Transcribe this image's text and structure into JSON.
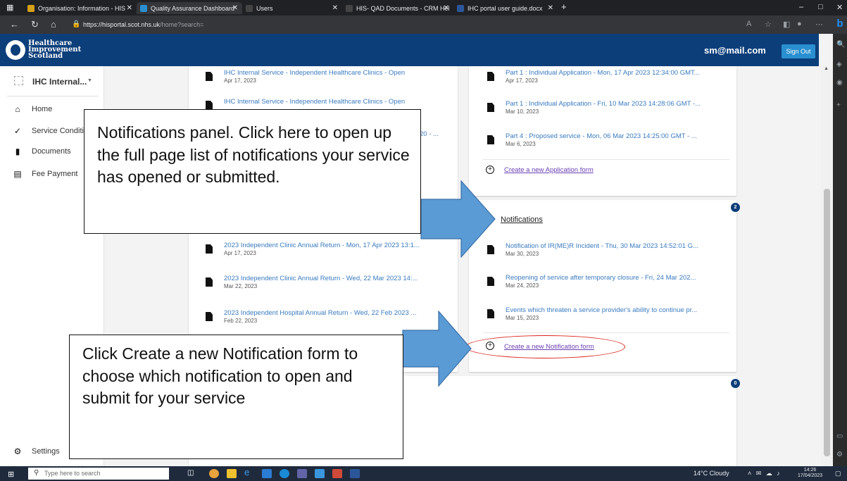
{
  "browser": {
    "tabs": [
      {
        "label": "Organisation: Information - HIS",
        "active": false
      },
      {
        "label": "Quality Assurance Dashboard",
        "active": true
      },
      {
        "label": "Users",
        "active": false
      },
      {
        "label": "HIS- QAD Documents - CRM Hel",
        "active": false
      },
      {
        "label": "IHC portal user guide.docx",
        "active": false
      }
    ],
    "new_tab": "+",
    "url_host": "https://hisportal.scot.nhs.uk",
    "url_path": "/home?search="
  },
  "header": {
    "brand_line1": "Healthcare",
    "brand_line2": "Improvement",
    "brand_line3": "Scotland",
    "user_email": "sm@mail.com",
    "signout_label": "Sign Out",
    "brand_color": "#0c3e7a"
  },
  "sidebar": {
    "org_label": "IHC Internal...",
    "items": [
      {
        "label": "Home",
        "icon": "home-icon"
      },
      {
        "label": "Service Conditi",
        "icon": "service-conditions-icon"
      },
      {
        "label": "Documents",
        "icon": "document-icon"
      },
      {
        "label": "Fee Payment",
        "icon": "fee-payment-icon"
      }
    ],
    "settings_label": "Settings"
  },
  "left_card": {
    "top_items": [
      {
        "title": "IHC Internal Service - Independent Healthcare Clinics - Open",
        "date": "Apr 17, 2023"
      },
      {
        "title": "IHC Internal Service - Independent Healthcare Clinics - Open",
        "date": ""
      },
      {
        "title": "20 - ...",
        "date": ""
      }
    ],
    "annual_items": [
      {
        "title": "2023 Independent Clinic Annual Return - Mon, 17 Apr 2023 13:1...",
        "date": "Apr 17, 2023"
      },
      {
        "title": "2023 Independent Clinic Annual Return - Wed, 22 Mar 2023 14:...",
        "date": "Mar 22, 2023"
      },
      {
        "title": "2023 Independent Hospital Annual Return - Wed, 22 Feb 2023 ...",
        "date": "Feb 22, 2023"
      }
    ]
  },
  "applications_card": {
    "items": [
      {
        "title": "Part 1 : Individual Application - Mon, 17 Apr 2023 12:34:00 GMT...",
        "date": "Apr 17, 2023"
      },
      {
        "title": "Part 1 : Individual Application - Fri, 10 Mar 2023 14:28:06 GMT -...",
        "date": "Mar 10, 2023"
      },
      {
        "title": "Part 4 : Proposed service - Mon, 06 Mar 2023 14:25:00 GMT - ...",
        "date": "Mar 6, 2023"
      }
    ],
    "create_link": "Create a new Application form"
  },
  "notifications_card": {
    "heading": "Notifications",
    "badge": "2",
    "items": [
      {
        "title": "Notification of IR(ME)R Incident - Thu, 30 Mar 2023 14:52:01 G...",
        "date": "Mar 30, 2023"
      },
      {
        "title": "Reopening of service after temporary closure - Fri, 24 Mar 202...",
        "date": "Mar 24, 2023"
      },
      {
        "title": "Events which threaten a service provider's ability to continue pr...",
        "date": "Mar 15, 2023"
      }
    ],
    "create_link": "Create a new Notification form"
  },
  "bottom_card": {
    "badge": "0"
  },
  "callouts": {
    "notifications_panel": "Notifications panel. Click here to open up the full page list of notifications your service has opened or submitted.",
    "create_notification": "Click Create a new Notification form to choose which notification to open and submit for your service",
    "arrow_color": "#5b9bd5",
    "highlight_color": "#d9261c"
  },
  "taskbar": {
    "search_placeholder": "Type here to search",
    "weather": "14°C  Cloudy",
    "time": "14:26",
    "date": "17/04/2023"
  }
}
